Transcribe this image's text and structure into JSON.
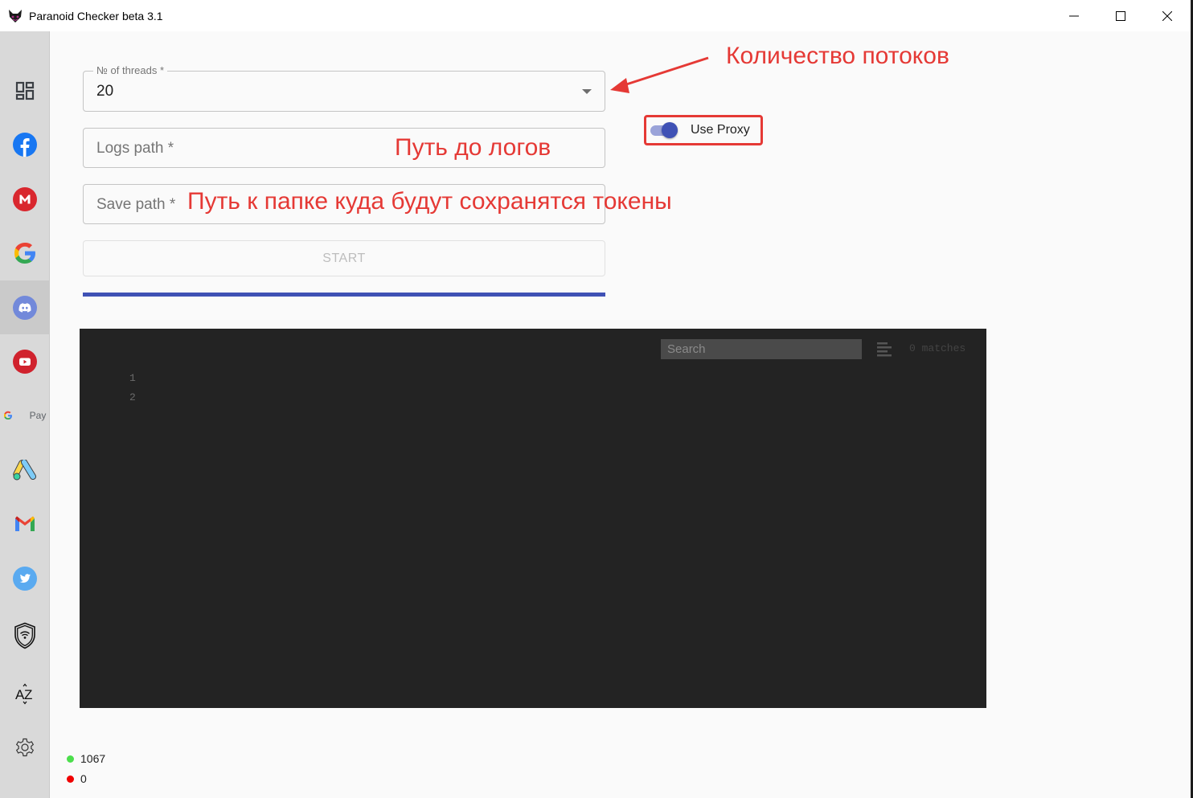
{
  "window": {
    "title": "Paranoid Checker beta 3.1",
    "app_icon": "cat-mask-icon",
    "controls": [
      "minimize",
      "maximize",
      "close"
    ]
  },
  "sidebar": {
    "active_index": 4,
    "items": [
      {
        "name": "dashboard",
        "icon": "dashboard-grid-icon"
      },
      {
        "name": "facebook",
        "icon": "facebook-icon"
      },
      {
        "name": "mega",
        "icon": "mega-icon"
      },
      {
        "name": "google",
        "icon": "google-icon"
      },
      {
        "name": "discord",
        "icon": "discord-icon"
      },
      {
        "name": "youtube",
        "icon": "youtube-icon"
      },
      {
        "name": "google-pay",
        "icon": "google-pay-icon",
        "label": "Pay"
      },
      {
        "name": "google-ads",
        "icon": "google-ads-icon"
      },
      {
        "name": "gmail",
        "icon": "gmail-icon"
      },
      {
        "name": "twitter",
        "icon": "twitter-icon"
      },
      {
        "name": "vpn-shield",
        "icon": "shield-wifi-icon"
      },
      {
        "name": "sort",
        "icon": "sort-az-icon",
        "label": "AZ"
      },
      {
        "name": "settings",
        "icon": "gear-icon"
      }
    ]
  },
  "form": {
    "threads": {
      "label": "№ of threads *",
      "value": "20"
    },
    "logs_path": {
      "placeholder": "Logs path *",
      "value": ""
    },
    "save_path": {
      "placeholder": "Save path *",
      "value": ""
    },
    "start_label": "START",
    "use_proxy": {
      "label": "Use Proxy",
      "checked": true
    },
    "progress_percent": 100
  },
  "annotations": {
    "threads": "Количество потоков",
    "logs_path": "Путь до логов",
    "save_path": "Путь к папке куда будут сохранятся токены"
  },
  "editor": {
    "search_placeholder": "Search",
    "matches": "0 matches",
    "line_numbers": [
      "1",
      "2"
    ]
  },
  "stats": {
    "valid": {
      "count": "1067",
      "color": "#4cde4c"
    },
    "invalid": {
      "count": "0",
      "color": "#f00000"
    }
  },
  "colors": {
    "accent": "#3f51b5",
    "annotation": "#e53935"
  }
}
